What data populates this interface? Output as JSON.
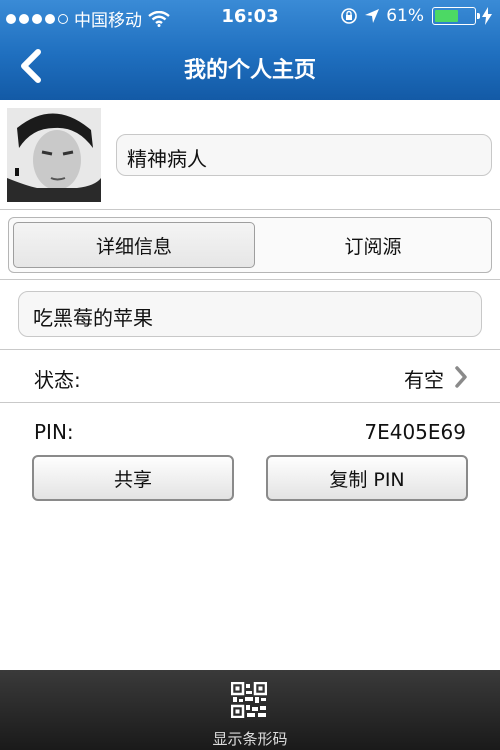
{
  "status_bar": {
    "carrier": "中国移动",
    "time": "16:03",
    "battery_percent": "61%",
    "battery_level": 0.61,
    "signal_bars_filled": 4,
    "icons": [
      "signal-dots-icon",
      "wifi-icon",
      "orientation-lock-icon",
      "location-arrow-icon",
      "battery-icon",
      "charging-bolt-icon"
    ]
  },
  "nav": {
    "title": "我的个人主页",
    "back_icon": "chevron-left-icon"
  },
  "profile": {
    "display_name": "精神病人"
  },
  "tabs": [
    {
      "label": "详细信息",
      "selected": true
    },
    {
      "label": "订阅源",
      "selected": false
    }
  ],
  "personal_message": "吃黑莓的苹果",
  "status_row": {
    "label": "状态:",
    "value": "有空"
  },
  "pin_row": {
    "label": "PIN:",
    "value": "7E405E69"
  },
  "buttons": {
    "share": "共享",
    "copy_pin": "复制 PIN"
  },
  "toolbar": {
    "barcode_label": "显示条形码",
    "icon": "qr-code-icon"
  },
  "colors": {
    "nav_blue": "#1f6fbf",
    "battery_green": "#4cd964",
    "toolbar_dark": "#222222"
  }
}
